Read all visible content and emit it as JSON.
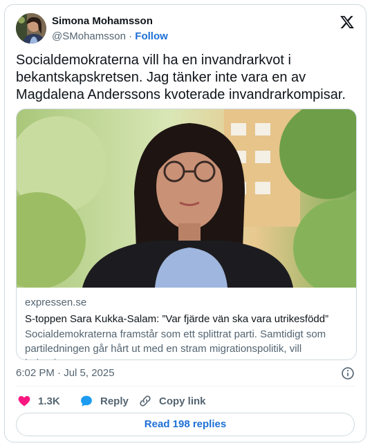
{
  "author": {
    "display_name": "Simona Mohamsson",
    "handle": "@SMohamsson",
    "separator": "·",
    "follow_label": "Follow"
  },
  "tweet": {
    "text": "Socialdemokraterna vill ha en invandrarkvot i bekantskapskretsen. Jag tänker inte vara en av Magdalena Anderssons kvoterade invandrarkompisar."
  },
  "link_card": {
    "domain": "expressen.se",
    "title": "S-toppen Sara Kukka-Salam: ”Var fjärde vän ska vara utrikesfödd”",
    "description": "Socialdemokraterna framstår som ett splittrat parti. Samtidigt som partiledningen går hårt ut med en stram migrationspolitik, vill ledande…"
  },
  "meta": {
    "timestamp": "6:02 PM · Jul 5, 2025"
  },
  "actions": {
    "likes": "1.3K",
    "reply_label": "Reply",
    "copy_link_label": "Copy link"
  },
  "read_replies_label": "Read 198 replies",
  "colors": {
    "accent": "#1d6fd6",
    "like": "#f91880",
    "reply": "#1d9bf0",
    "muted": "#536471",
    "border": "#cfd9de"
  },
  "icons": [
    "x-logo-icon",
    "info-icon",
    "heart-icon",
    "reply-bubble-icon",
    "link-icon"
  ]
}
